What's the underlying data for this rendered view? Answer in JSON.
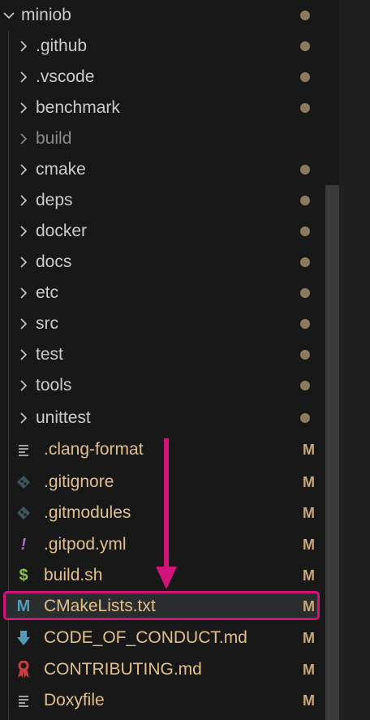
{
  "explorer": {
    "root": {
      "label": "miniob",
      "expanded": true,
      "status": "dot"
    },
    "items": [
      {
        "type": "folder",
        "label": ".github",
        "status": "dot",
        "dim": false
      },
      {
        "type": "folder",
        "label": ".vscode",
        "status": "dot",
        "dim": false
      },
      {
        "type": "folder",
        "label": "benchmark",
        "status": "dot",
        "dim": false
      },
      {
        "type": "folder",
        "label": "build",
        "status": "",
        "dim": true
      },
      {
        "type": "folder",
        "label": "cmake",
        "status": "dot",
        "dim": false
      },
      {
        "type": "folder",
        "label": "deps",
        "status": "dot",
        "dim": false
      },
      {
        "type": "folder",
        "label": "docker",
        "status": "dot",
        "dim": false
      },
      {
        "type": "folder",
        "label": "docs",
        "status": "dot",
        "dim": false
      },
      {
        "type": "folder",
        "label": "etc",
        "status": "dot",
        "dim": false
      },
      {
        "type": "folder",
        "label": "src",
        "status": "dot",
        "dim": false
      },
      {
        "type": "folder",
        "label": "test",
        "status": "dot",
        "dim": false
      },
      {
        "type": "folder",
        "label": "tools",
        "status": "dot",
        "dim": false
      },
      {
        "type": "folder",
        "label": "unittest",
        "status": "dot",
        "dim": false
      },
      {
        "type": "file",
        "label": ".clang-format",
        "status": "M",
        "icon": "lines-icon"
      },
      {
        "type": "file",
        "label": ".gitignore",
        "status": "M",
        "icon": "git-icon"
      },
      {
        "type": "file",
        "label": ".gitmodules",
        "status": "M",
        "icon": "git-icon"
      },
      {
        "type": "file",
        "label": ".gitpod.yml",
        "status": "M",
        "icon": "exclamation-icon"
      },
      {
        "type": "file",
        "label": "build.sh",
        "status": "M",
        "icon": "dollar-icon"
      },
      {
        "type": "file",
        "label": "CMakeLists.txt",
        "status": "M",
        "icon": "cmake-m-icon",
        "highlighted": true
      },
      {
        "type": "file",
        "label": "CODE_OF_CONDUCT.md",
        "status": "M",
        "icon": "markdown-arrow-icon"
      },
      {
        "type": "file",
        "label": "CONTRIBUTING.md",
        "status": "M",
        "icon": "ribbon-icon"
      },
      {
        "type": "file",
        "label": "Doxyfile",
        "status": "M",
        "icon": "lines-icon"
      }
    ]
  },
  "annotation": {
    "arrow_color": "#d1137a",
    "box_color": "#d1137a"
  },
  "colors": {
    "modified": "#e2c08d",
    "text": "#cccccc",
    "dim": "#8a8a8a",
    "accent": "#d1137a"
  }
}
